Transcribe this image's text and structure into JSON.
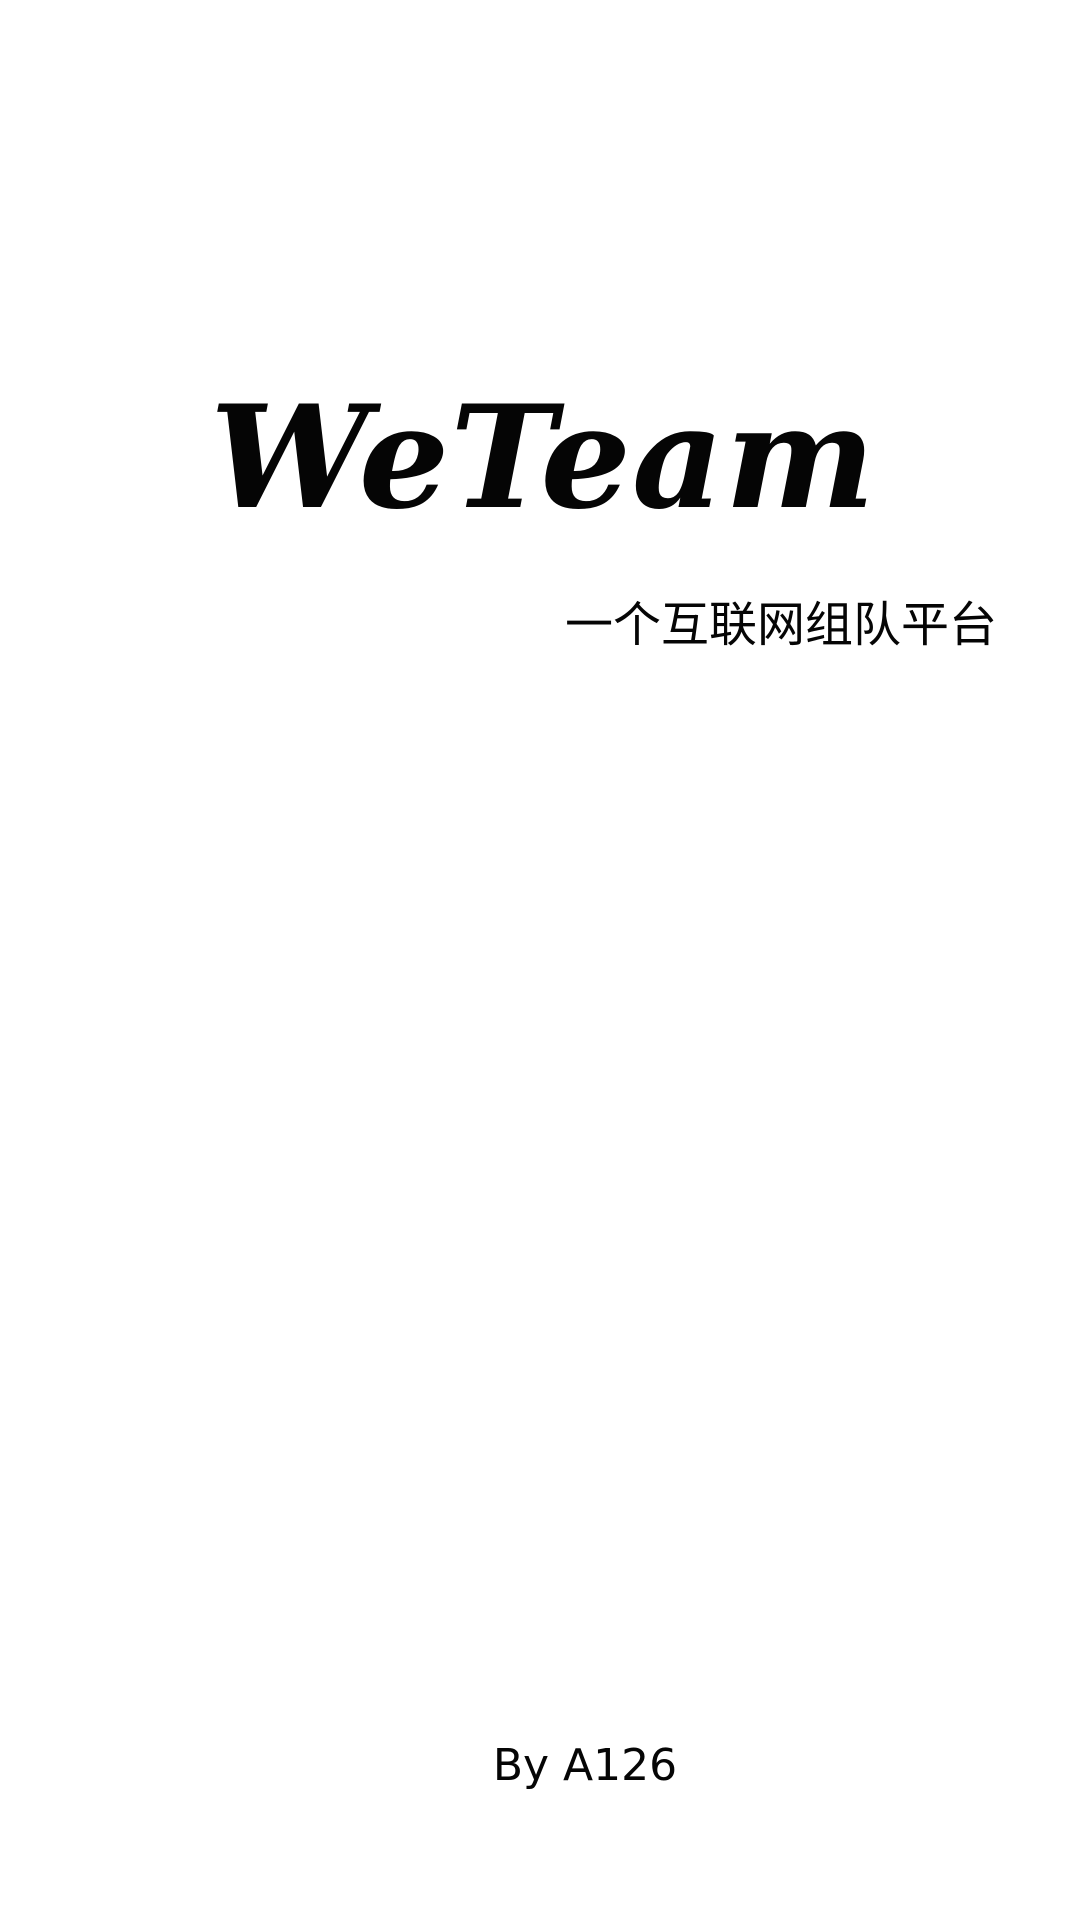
{
  "splash": {
    "title": "WeTeam",
    "subtitle": "一个互联网组队平台",
    "credit": "By A126"
  }
}
